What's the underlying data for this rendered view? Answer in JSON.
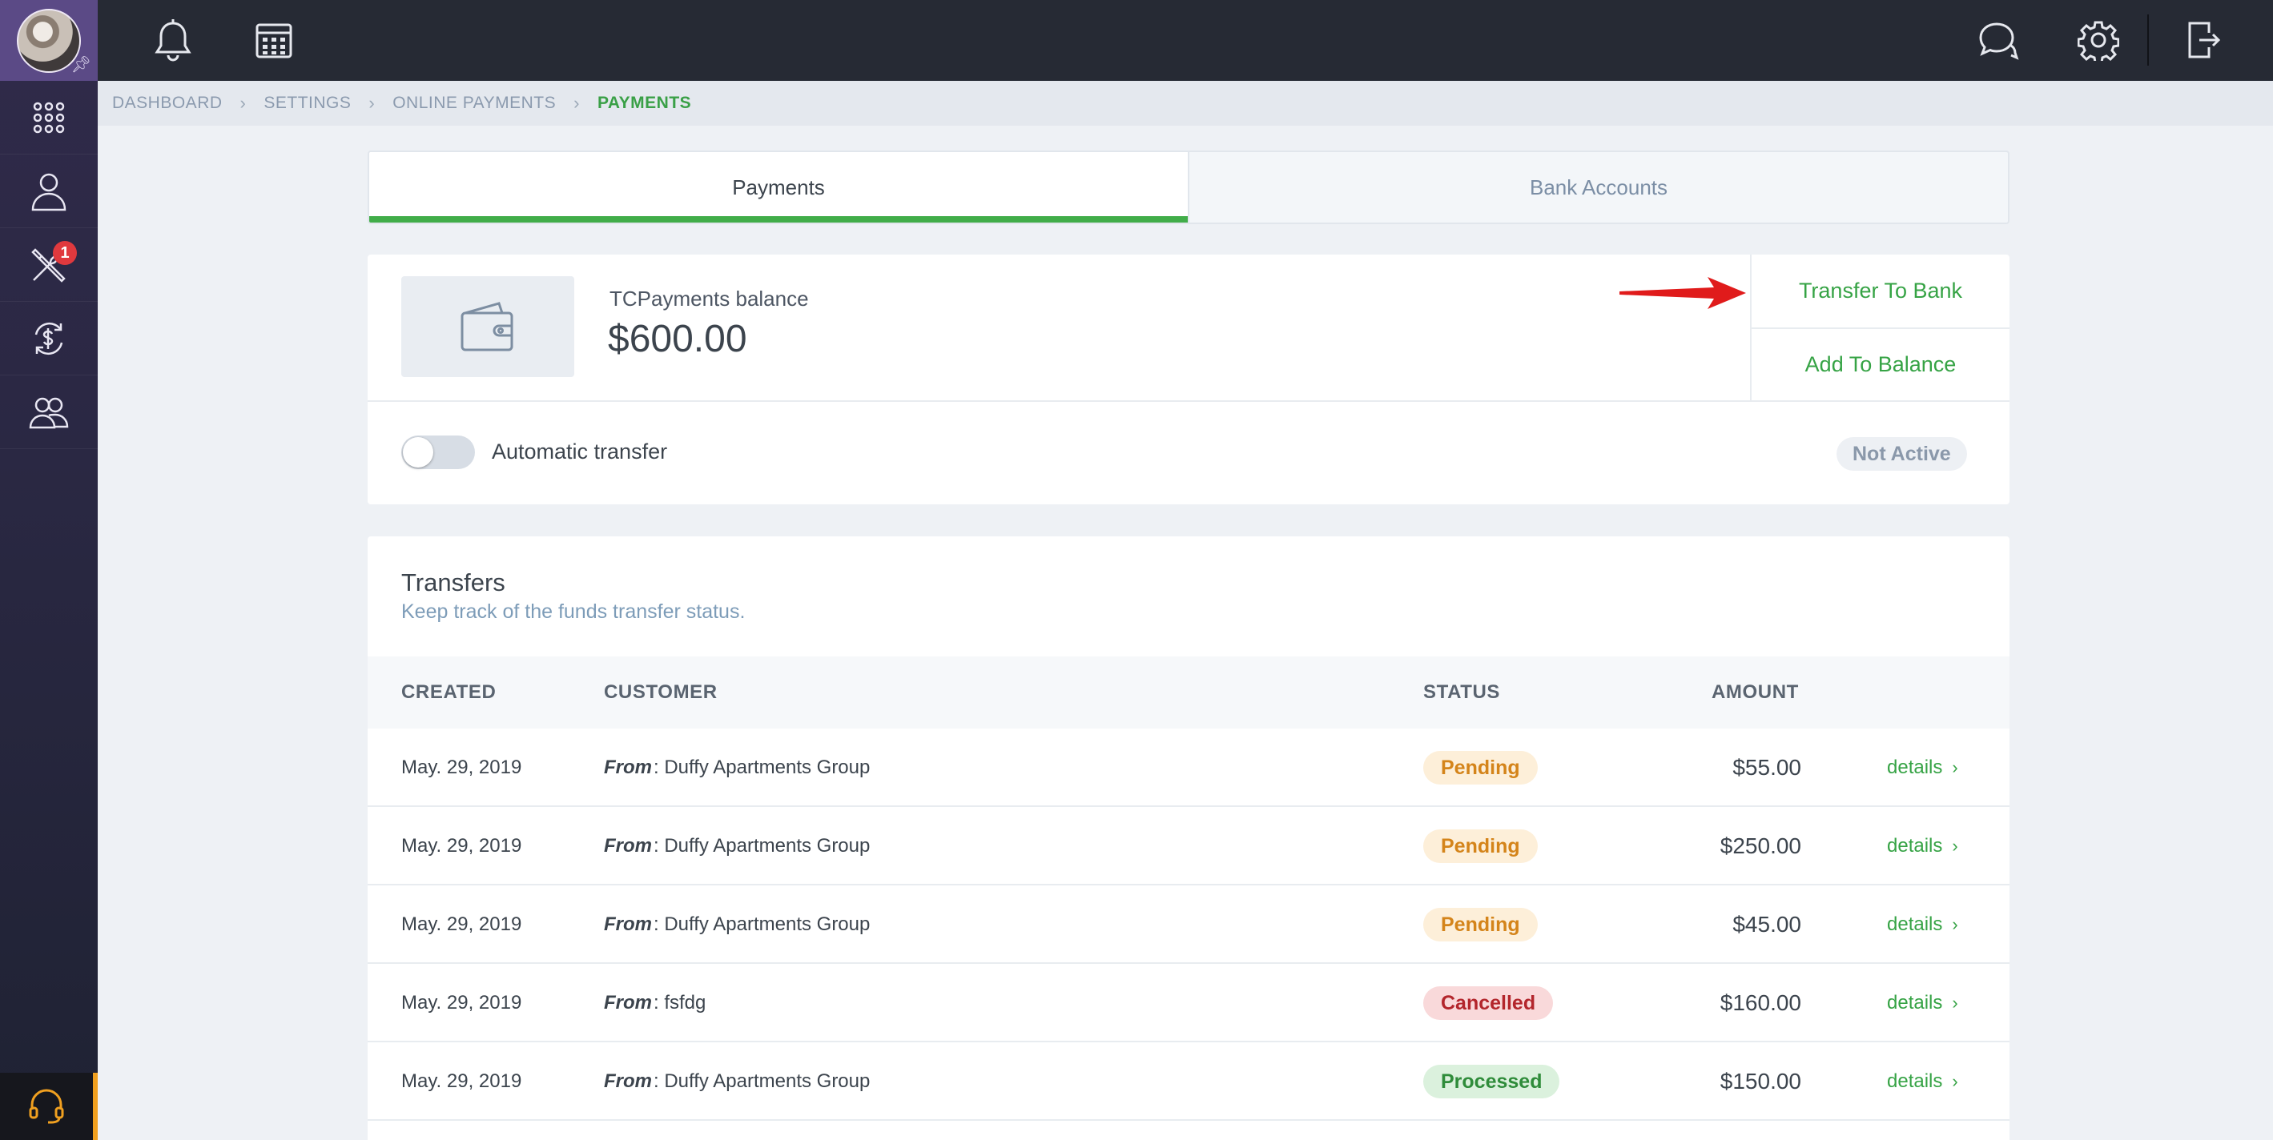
{
  "sidebar": {
    "badge_count": "1"
  },
  "breadcrumb": {
    "items": [
      "DASHBOARD",
      "SETTINGS",
      "ONLINE PAYMENTS"
    ],
    "current": "PAYMENTS"
  },
  "tabs": [
    {
      "label": "Payments",
      "active": true
    },
    {
      "label": "Bank Accounts",
      "active": false
    }
  ],
  "balance": {
    "label": "TCPayments balance",
    "amount": "$600.00",
    "transfer_to_bank": "Transfer To Bank",
    "add_to_balance": "Add To Balance",
    "auto_transfer_label": "Automatic transfer",
    "auto_transfer_status": "Not Active",
    "auto_transfer_enabled": false
  },
  "transfers": {
    "title": "Transfers",
    "subtitle": "Keep track of the funds transfer status.",
    "columns": [
      "CREATED",
      "CUSTOMER",
      "STATUS",
      "AMOUNT"
    ],
    "from_label": "From",
    "details_label": "details",
    "rows": [
      {
        "created": "May. 29, 2019",
        "customer": ": Duffy Apartments Group",
        "status": "Pending",
        "amount": "$55.00"
      },
      {
        "created": "May. 29, 2019",
        "customer": ": Duffy Apartments Group",
        "status": "Pending",
        "amount": "$250.00"
      },
      {
        "created": "May. 29, 2019",
        "customer": ": Duffy Apartments Group",
        "status": "Pending",
        "amount": "$45.00"
      },
      {
        "created": "May. 29, 2019",
        "customer": ": fsfdg",
        "status": "Cancelled",
        "amount": "$160.00"
      },
      {
        "created": "May. 29, 2019",
        "customer": ": Duffy Apartments Group",
        "status": "Processed",
        "amount": "$150.00"
      }
    ]
  },
  "colors": {
    "accent_green": "#41ad49",
    "pending_bg": "#fdefd9",
    "pending_text": "#d4841a",
    "cancelled_bg": "#f9d9da",
    "cancelled_text": "#b3262c",
    "processed_bg": "#dbf1dd",
    "processed_text": "#2f8c3a",
    "arrow_red": "#e01b1b"
  },
  "icons": {
    "topbar_left": [
      "bell-icon",
      "calendar-icon"
    ],
    "topbar_right": [
      "chat-icon",
      "gear-icon",
      "logout-icon"
    ],
    "sidebar": [
      "apps-grid-icon",
      "user-icon",
      "tools-icon",
      "dollar-refresh-icon",
      "team-icon",
      "headset-icon"
    ]
  }
}
